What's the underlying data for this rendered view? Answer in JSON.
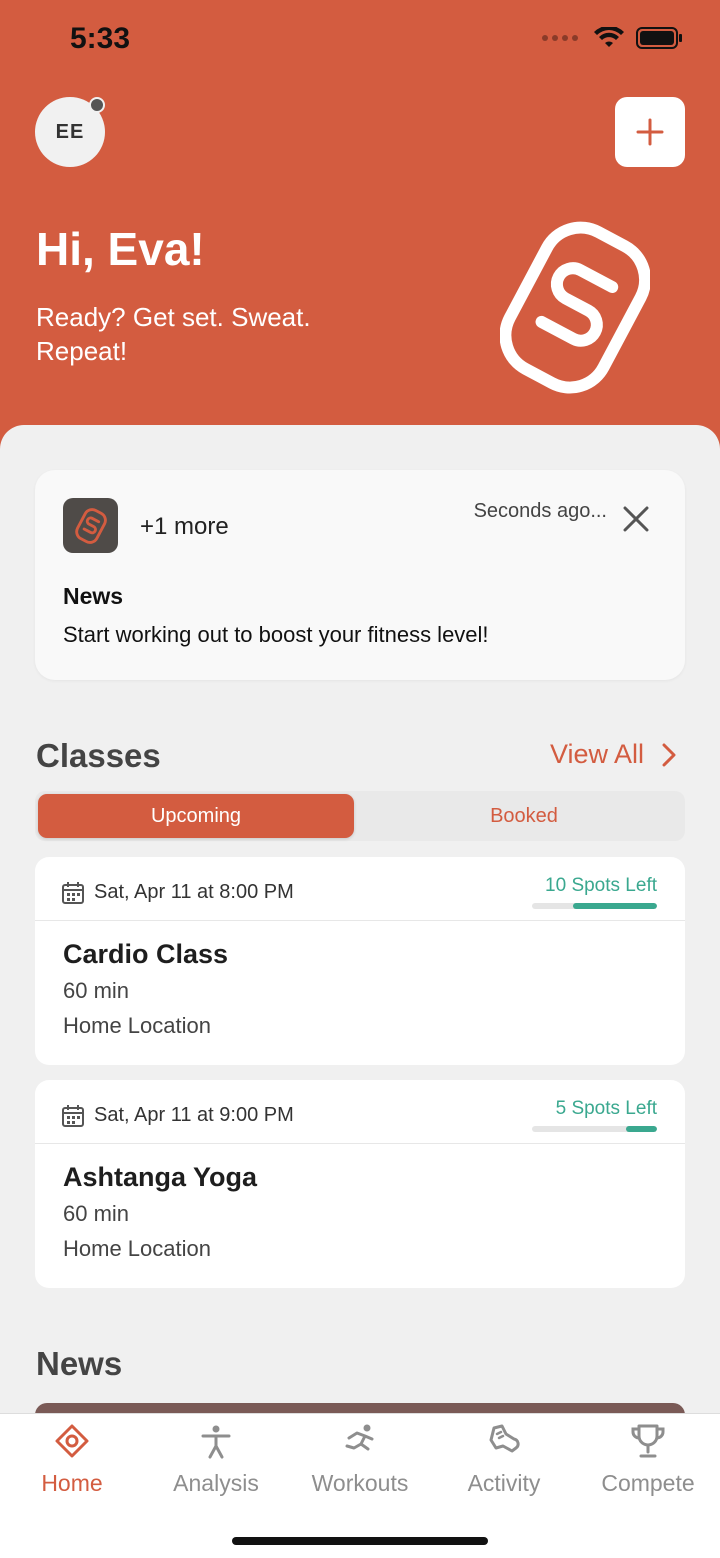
{
  "status_bar": {
    "time": "5:33"
  },
  "header": {
    "avatar_initials": "EE",
    "greeting": "Hi, Eva!",
    "tagline": "Ready? Get set. Sweat. Repeat!"
  },
  "notification": {
    "more": "+1 more",
    "time": "Seconds ago...",
    "title": "News",
    "body": "Start working out to boost your fitness level!"
  },
  "classes": {
    "title": "Classes",
    "view_all": "View All",
    "tabs": {
      "upcoming": "Upcoming",
      "booked": "Booked"
    },
    "items": [
      {
        "date": "Sat, Apr 11 at 8:00 PM",
        "spots": "10 Spots Left",
        "spots_fill_fraction": 0.67,
        "name": "Cardio Class",
        "duration": "60 min",
        "location": "Home Location"
      },
      {
        "date": "Sat, Apr 11 at 9:00 PM",
        "spots": "5 Spots Left",
        "spots_fill_fraction": 0.25,
        "name": "Ashtanga Yoga",
        "duration": "60 min",
        "location": "Home Location"
      }
    ]
  },
  "news": {
    "title": "News"
  },
  "tabbar": {
    "items": [
      {
        "label": "Home",
        "icon": "home-icon",
        "active": true
      },
      {
        "label": "Analysis",
        "icon": "person-icon",
        "active": false
      },
      {
        "label": "Workouts",
        "icon": "runner-icon",
        "active": false
      },
      {
        "label": "Activity",
        "icon": "shoe-icon",
        "active": false
      },
      {
        "label": "Compete",
        "icon": "trophy-icon",
        "active": false
      }
    ]
  },
  "colors": {
    "brand": "#d35c40",
    "accent_green": "#3aa88f",
    "background": "#f0f0f0"
  }
}
